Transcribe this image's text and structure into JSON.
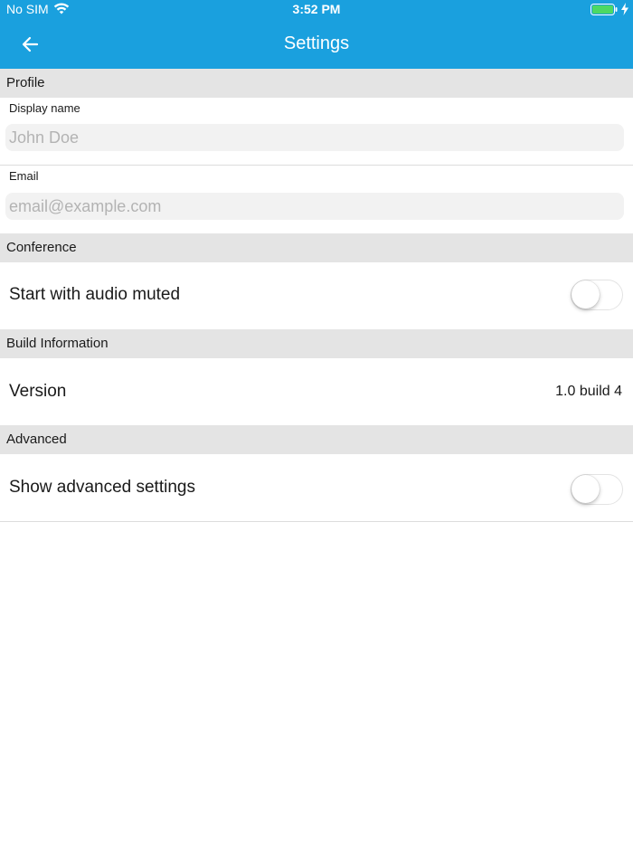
{
  "status_bar": {
    "carrier": "No SIM",
    "time": "3:52 PM"
  },
  "navbar": {
    "title": "Settings",
    "back_icon": "arrow-left-icon"
  },
  "colors": {
    "accent": "#1aa0de",
    "section_bg": "#e4e4e4",
    "battery": "#4cd964"
  },
  "sections": {
    "profile": {
      "header": "Profile",
      "display_name": {
        "label": "Display name",
        "placeholder": "John Doe",
        "value": ""
      },
      "email": {
        "label": "Email",
        "placeholder": "email@example.com",
        "value": ""
      }
    },
    "conference": {
      "header": "Conference",
      "audio_muted": {
        "label": "Start with audio muted",
        "on": false
      }
    },
    "build": {
      "header": "Build Information",
      "version_label": "Version",
      "version_value": "1.0 build 4"
    },
    "advanced": {
      "header": "Advanced",
      "show_advanced": {
        "label": "Show advanced settings",
        "on": false
      }
    }
  }
}
